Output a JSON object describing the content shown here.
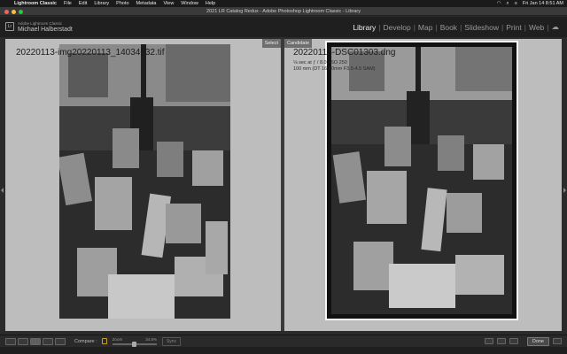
{
  "menubar": {
    "app": "Lightroom Classic",
    "menus": [
      "File",
      "Edit",
      "Library",
      "Photo",
      "Metadata",
      "View",
      "Window",
      "Help"
    ],
    "clock": "Fri Jan 14  8:51 AM"
  },
  "window": {
    "title": "2021 LR Catalog Redux - Adobe Photoshop Lightroom Classic - Library"
  },
  "identity": {
    "line1": "Adobe Lightroom Classic",
    "line2": "Michael Halberstadt"
  },
  "modules": [
    {
      "label": "Library",
      "active": true
    },
    {
      "label": "Develop"
    },
    {
      "label": "Map"
    },
    {
      "label": "Book"
    },
    {
      "label": "Slideshow"
    },
    {
      "label": "Print"
    },
    {
      "label": "Web"
    }
  ],
  "compare": {
    "select": {
      "tag": "Select",
      "filename": "20220113-img20220113_14034632.tif"
    },
    "candidate": {
      "tag": "Candidate",
      "filename": "20220113-DSC01303.dng",
      "exposure": "⅛ sec at ƒ / 8.0, ISO 250",
      "lens": "100 mm (DT 16-80mm F3.5-4.5 SAM)"
    }
  },
  "toolbar": {
    "compare_label": "Compare :",
    "zoom_label": "Zoom",
    "zoom_value": "34.5%",
    "sync_label": "Sync",
    "done_label": "Done"
  },
  "colors": {
    "background": "#2b2b2b",
    "pane": "#bdbdbd",
    "lock": "#c9a227"
  }
}
